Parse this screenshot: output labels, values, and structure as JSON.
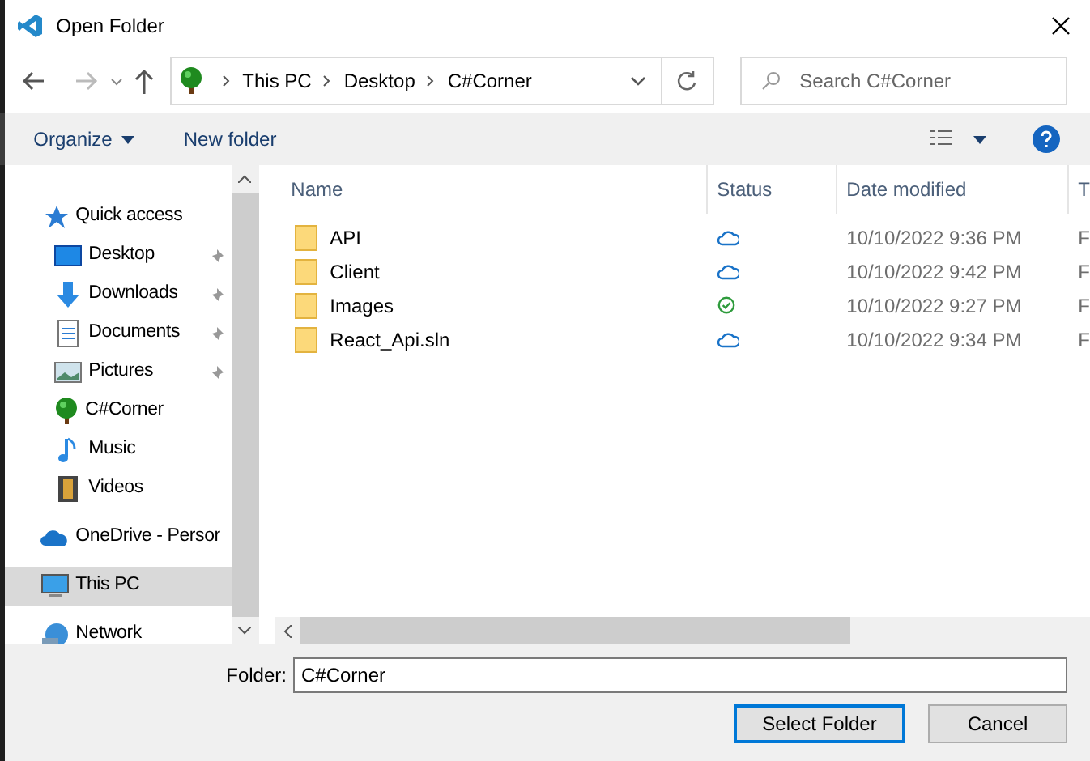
{
  "window": {
    "title": "Open Folder"
  },
  "address": {
    "crumbs": [
      "This PC",
      "Desktop",
      "C#Corner"
    ]
  },
  "search": {
    "placeholder": "Search C#Corner"
  },
  "toolbar": {
    "organize": "Organize",
    "new_folder": "New folder"
  },
  "sidebar": {
    "items": [
      {
        "label": "Quick access",
        "kind": "star",
        "pinned": false,
        "selected": false,
        "children": [
          {
            "label": "Desktop",
            "kind": "desktop",
            "pinned": true,
            "selected": false
          },
          {
            "label": "Downloads",
            "kind": "download",
            "pinned": true,
            "selected": false
          },
          {
            "label": "Documents",
            "kind": "document",
            "pinned": true,
            "selected": false
          },
          {
            "label": "Pictures",
            "kind": "picture",
            "pinned": true,
            "selected": false
          },
          {
            "label": "C#Corner",
            "kind": "tree",
            "pinned": false,
            "selected": false
          },
          {
            "label": "Music",
            "kind": "music",
            "pinned": false,
            "selected": false
          },
          {
            "label": "Videos",
            "kind": "video",
            "pinned": false,
            "selected": false
          }
        ]
      },
      {
        "label": "OneDrive - Persor",
        "kind": "cloud",
        "pinned": false,
        "selected": false
      },
      {
        "label": "This PC",
        "kind": "pc",
        "pinned": false,
        "selected": true
      },
      {
        "label": "Network",
        "kind": "network",
        "pinned": false,
        "selected": false
      }
    ]
  },
  "table": {
    "columns": [
      "Name",
      "Status",
      "Date modified",
      "T"
    ],
    "rows": [
      {
        "name": "API",
        "kind": "cloud",
        "date": "10/10/2022 9:36 PM",
        "column_4": "F"
      },
      {
        "name": "Client",
        "kind": "cloud",
        "date": "10/10/2022 9:42 PM",
        "column_4": "F"
      },
      {
        "name": "Images",
        "kind": "synced",
        "date": "10/10/2022 9:27 PM",
        "column_4": "F"
      },
      {
        "name": "React_Api.sln",
        "kind": "cloud",
        "date": "10/10/2022 9:34 PM",
        "column_4": "F"
      }
    ]
  },
  "footer": {
    "folder_label": "Folder:",
    "folder_value": "C#Corner",
    "buttons": [
      "Select Folder",
      "Cancel"
    ]
  }
}
